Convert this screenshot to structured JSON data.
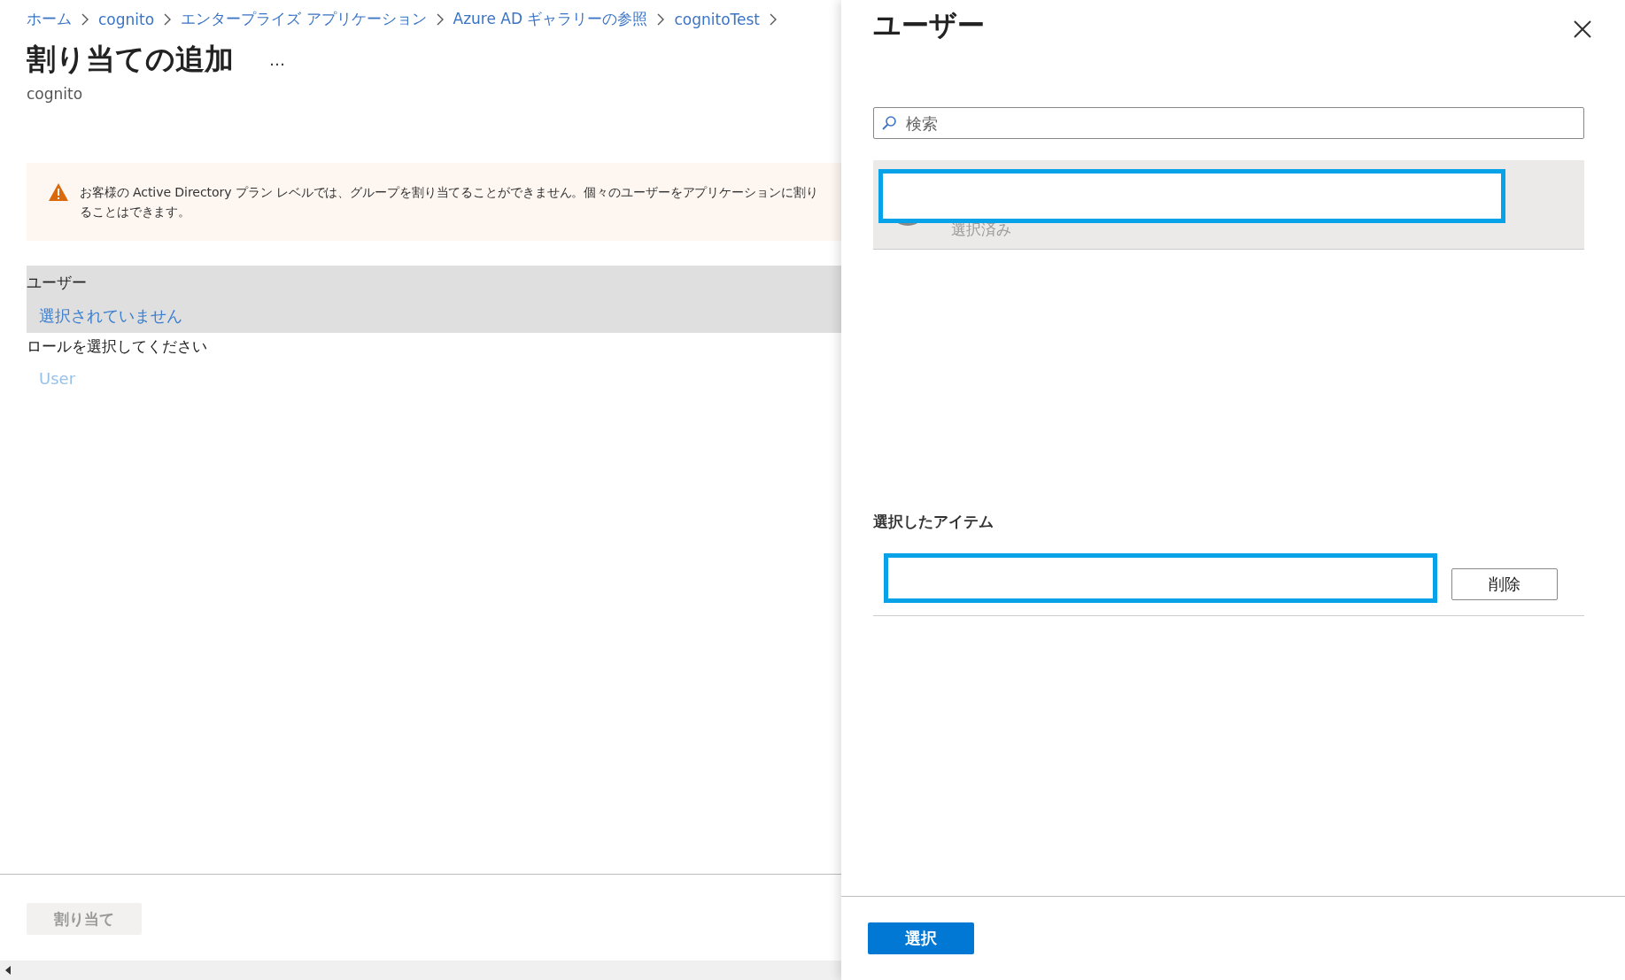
{
  "breadcrumb": [
    {
      "label": "ホーム"
    },
    {
      "label": "cognito"
    },
    {
      "label": "エンタープライズ アプリケーション"
    },
    {
      "label": "Azure AD ギャラリーの参照"
    },
    {
      "label": "cognitoTest"
    }
  ],
  "page": {
    "title": "割り当ての追加",
    "more": "…",
    "subtitle": "cognito"
  },
  "warning": {
    "lines": [
      "お客様の Active Directory プラン レベルでは、グループを割り当てることができません。個々のユーザーをアプリケーションに割り",
      "ることはできます。"
    ]
  },
  "users": {
    "label": "ユーザー",
    "value": "選択されていません"
  },
  "role": {
    "label": "ロールを選択してください",
    "value": "User",
    "disabled": true
  },
  "footer": {
    "assign_button": "割り当て",
    "disabled": true
  },
  "panel": {
    "title": "ユーザー",
    "search": {
      "placeholder": "検索"
    },
    "results": [
      {
        "status": "選択済み",
        "selected": true
      }
    ],
    "selected_heading": "選択したアイテム",
    "selected_items": [
      {
        "remove_button": "削除"
      }
    ],
    "select_button": "選択"
  }
}
